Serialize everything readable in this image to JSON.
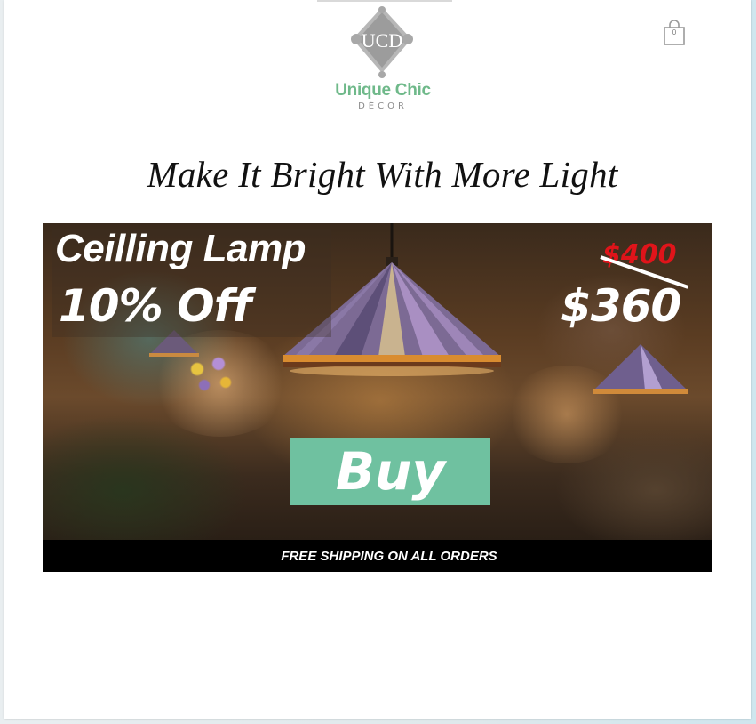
{
  "header": {
    "logo": {
      "monogram": "UCD",
      "name": "Unique Chic",
      "tagline": "DÉCOR"
    },
    "cart": {
      "icon": "shopping-bag-icon",
      "count": "0"
    }
  },
  "main": {
    "headline": "Make It Bright With More Light",
    "banner": {
      "product_name": "Ceilling Lamp",
      "discount": "10% Off",
      "old_price": "$400",
      "new_price": "$360",
      "buy_label": "Buy",
      "shipping_text": "FREE SHIPPING ON ALL ORDERS"
    }
  },
  "colors": {
    "brand_green": "#6fb98a",
    "buy_button": "#6fc1a0",
    "old_price": "#e0141a",
    "shipping_bar": "#000000"
  }
}
